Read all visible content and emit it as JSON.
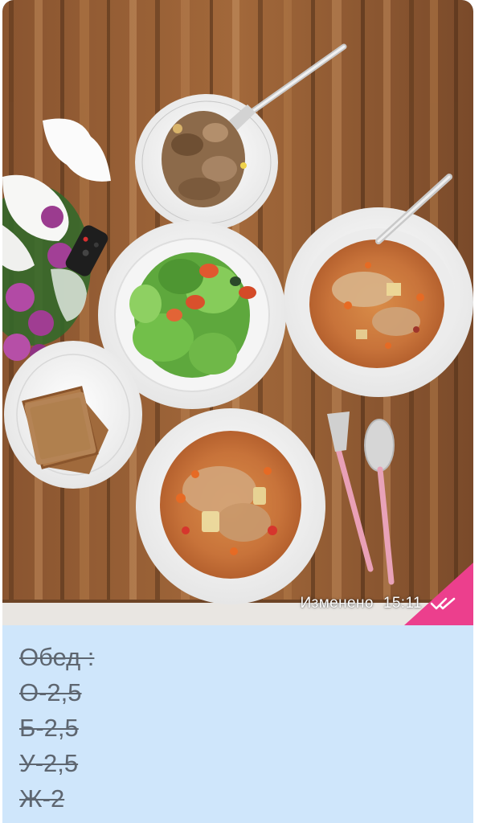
{
  "message": {
    "photo_meta": {
      "edited_label": "Изменено",
      "time": "15:11",
      "status_icon": "double-check-icon"
    },
    "text_lines": [
      "Обед :",
      "О-2,5",
      "Б-2,5",
      "У-2,5",
      "Ж-2"
    ],
    "colors": {
      "bubble_background": "#cfe6fb",
      "text": "#5e6670",
      "meta_text": "#ffffff"
    }
  }
}
